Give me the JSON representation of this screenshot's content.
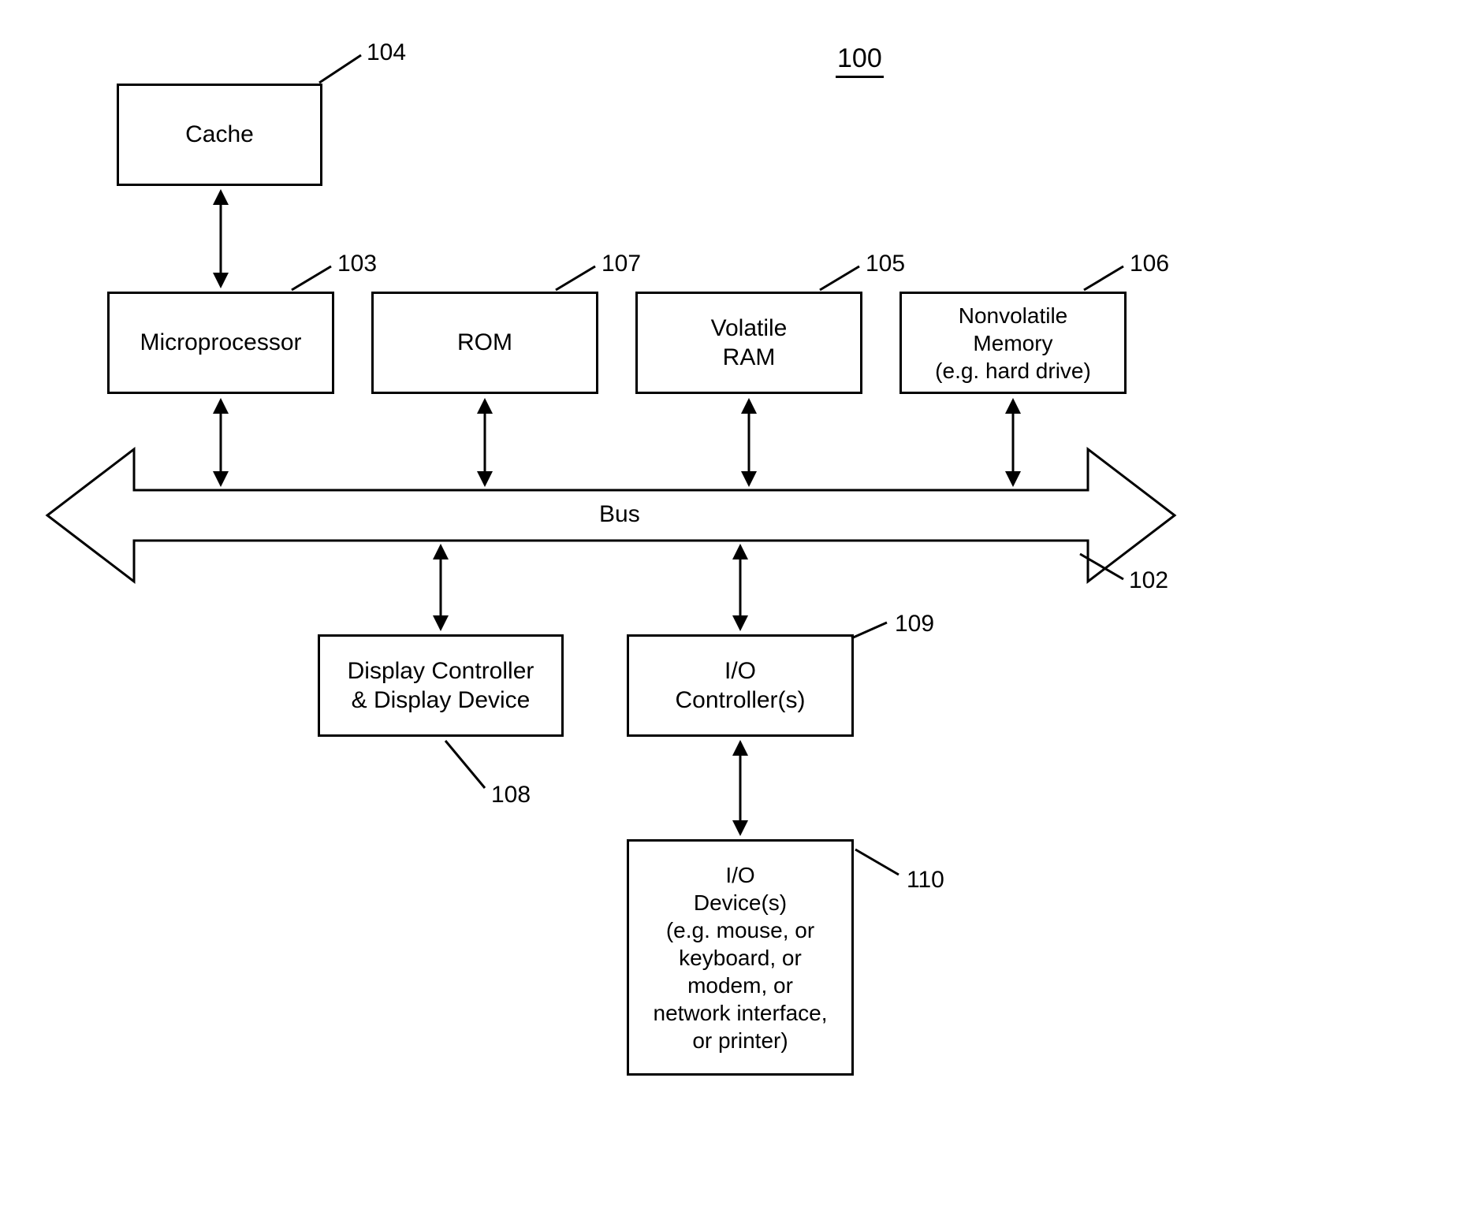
{
  "figure_number": "100",
  "blocks": {
    "cache": {
      "label": "Cache",
      "ref": "104"
    },
    "microprocessor": {
      "label": "Microprocessor",
      "ref": "103"
    },
    "rom": {
      "label": "ROM",
      "ref": "107"
    },
    "vram": {
      "label": "Volatile\nRAM",
      "ref": "105"
    },
    "nvmem": {
      "label": "Nonvolatile\nMemory\n(e.g. hard drive)",
      "ref": "106"
    },
    "display": {
      "label": "Display Controller\n& Display Device",
      "ref": "108"
    },
    "ioctrl": {
      "label": "I/O\nController(s)",
      "ref": "109"
    },
    "iodev": {
      "label": "I/O\nDevice(s)\n(e.g. mouse, or\nkeyboard, or\nmodem, or\nnetwork interface,\nor printer)",
      "ref": "110"
    }
  },
  "bus": {
    "label": "Bus",
    "ref": "102"
  }
}
